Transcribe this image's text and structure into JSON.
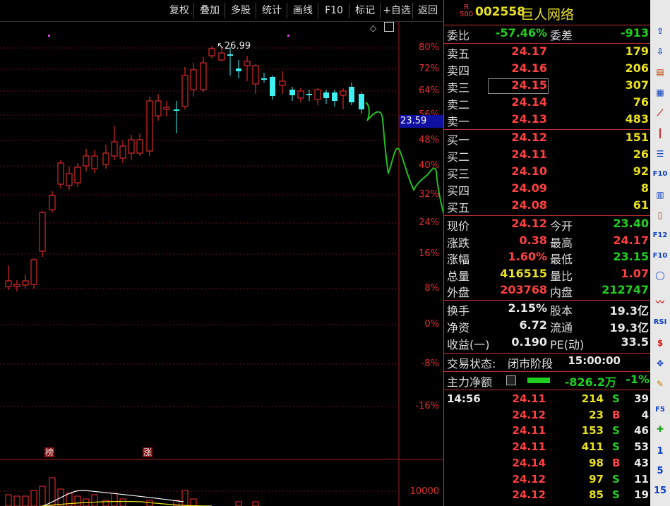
{
  "toolbar": {
    "buttons": [
      "复权",
      "叠加",
      "多股",
      "统计",
      "画线",
      "F10",
      "标记",
      "+自选",
      "返回"
    ]
  },
  "stock": {
    "badge_top": "R",
    "badge_bottom": "500",
    "code": "002558",
    "name": "巨人网络"
  },
  "chart": {
    "y_axis_labels": [
      "80%",
      "72%",
      "64%",
      "56%",
      "48%",
      "40%",
      "32%",
      "24%",
      "16%",
      "8%",
      "0%",
      "-8%",
      "-16%"
    ],
    "high_label": "26.99",
    "current_price_tag": "23.59",
    "volume_axis_label": "10000",
    "tags": [
      "榜",
      "涨"
    ]
  },
  "chart_data": {
    "type": "candlestick",
    "note_series": "daily candles with percent axis",
    "ylim_percent": [
      -16,
      80
    ],
    "high_price": 26.99,
    "current_price": 23.59
  },
  "quote": {
    "wei_bi_label": "委比",
    "wei_bi": "-57.46%",
    "wei_cha_label": "委差",
    "wei_cha": "-913",
    "asks": [
      {
        "label": "卖五",
        "price": "24.17",
        "vol": "179"
      },
      {
        "label": "卖四",
        "price": "24.16",
        "vol": "206"
      },
      {
        "label": "卖三",
        "price": "24.15",
        "vol": "307"
      },
      {
        "label": "卖二",
        "price": "24.14",
        "vol": "76"
      },
      {
        "label": "卖一",
        "price": "24.13",
        "vol": "483"
      }
    ],
    "bids": [
      {
        "label": "买一",
        "price": "24.12",
        "vol": "151"
      },
      {
        "label": "买二",
        "price": "24.11",
        "vol": "26"
      },
      {
        "label": "买三",
        "price": "24.10",
        "vol": "92"
      },
      {
        "label": "买四",
        "price": "24.09",
        "vol": "8"
      },
      {
        "label": "买五",
        "price": "24.08",
        "vol": "61"
      }
    ],
    "stats": [
      {
        "l1": "现价",
        "v1": "24.12",
        "c1": "red",
        "l2": "今开",
        "v2": "23.40",
        "c2": "green"
      },
      {
        "l1": "涨跌",
        "v1": "0.38",
        "c1": "red",
        "l2": "最高",
        "v2": "24.17",
        "c2": "red"
      },
      {
        "l1": "涨幅",
        "v1": "1.60%",
        "c1": "red",
        "l2": "最低",
        "v2": "23.15",
        "c2": "green"
      },
      {
        "l1": "总量",
        "v1": "416515",
        "c1": "yellow",
        "l2": "量比",
        "v2": "1.07",
        "c2": "red"
      },
      {
        "l1": "外盘",
        "v1": "203768",
        "c1": "red",
        "l2": "内盘",
        "v2": "212747",
        "c2": "green"
      }
    ],
    "stats2": [
      {
        "l1": "换手",
        "v1": "2.15%",
        "l2": "股本",
        "v2": "19.3亿"
      },
      {
        "l1": "净资",
        "v1": "6.72",
        "l2": "流通",
        "v2": "19.3亿"
      },
      {
        "l1": "收益(一)",
        "v1": "0.190",
        "l2": "PE(动)",
        "v2": "33.5"
      }
    ],
    "trade_status_label": "交易状态:",
    "trade_status": "闭市阶段",
    "trade_time": "15:00:00",
    "main_flow_label": "主力净额",
    "main_flow": "-826.2万",
    "main_flow_pct": "-1%"
  },
  "ticks": [
    {
      "time": "14:56",
      "price": "24.11",
      "vol": "214",
      "side": "S",
      "n": "39"
    },
    {
      "time": "",
      "price": "24.12",
      "vol": "23",
      "side": "B",
      "n": "4"
    },
    {
      "time": "",
      "price": "24.11",
      "vol": "153",
      "side": "S",
      "n": "46"
    },
    {
      "time": "",
      "price": "24.11",
      "vol": "411",
      "side": "S",
      "n": "53"
    },
    {
      "time": "",
      "price": "24.14",
      "vol": "98",
      "side": "B",
      "n": "43"
    },
    {
      "time": "",
      "price": "24.12",
      "vol": "97",
      "side": "S",
      "n": "11"
    },
    {
      "time": "",
      "price": "24.12",
      "vol": "85",
      "side": "S",
      "n": "19"
    }
  ],
  "sidebar_numbers": [
    "1",
    "5",
    "15"
  ]
}
